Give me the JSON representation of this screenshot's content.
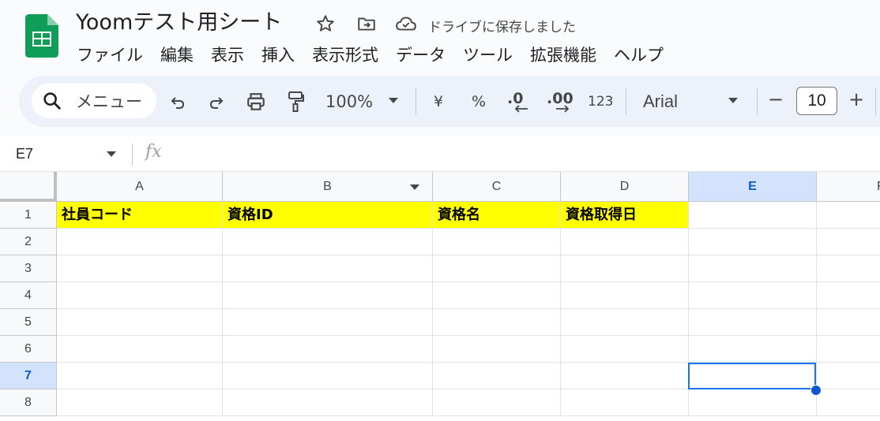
{
  "header": {
    "title": "Yoomテスト用シート",
    "save_status": "ドライブに保存しました",
    "menu": [
      "ファイル",
      "編集",
      "表示",
      "挿入",
      "表示形式",
      "データ",
      "ツール",
      "拡張機能",
      "ヘルプ"
    ]
  },
  "toolbar": {
    "search_label": "メニュー",
    "zoom": "100%",
    "currency": "¥",
    "percent": "%",
    "decimal_decrease": ".0",
    "decimal_increase": ".00",
    "number_format": "123",
    "font": "Arial",
    "font_size": "10",
    "minus": "−",
    "plus": "+"
  },
  "formula_bar": {
    "name_box": "E7",
    "fx": "fx"
  },
  "grid": {
    "columns": [
      "A",
      "B",
      "C",
      "D",
      "E",
      "F"
    ],
    "selected_column": "E",
    "rows": [
      "1",
      "2",
      "3",
      "4",
      "5",
      "6",
      "7",
      "8"
    ],
    "selected_row": "7",
    "header_row": [
      "社員コード",
      "資格ID",
      "資格名",
      "資格取得日"
    ],
    "header_fill": "#ffff00",
    "selection_color": "#1a73e8"
  },
  "colors": {
    "sheets_green": "#0f9d58",
    "toolbar_bg": "#edf2fa"
  }
}
